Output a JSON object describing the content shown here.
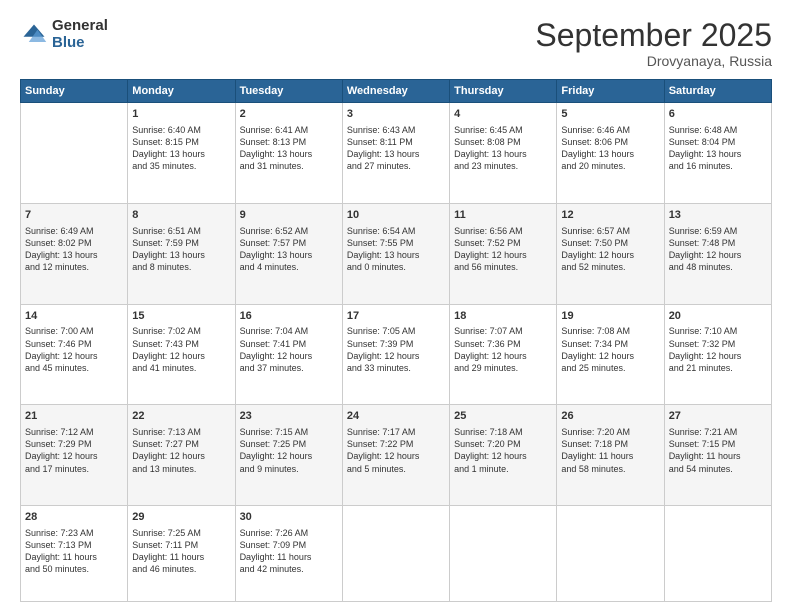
{
  "logo": {
    "general": "General",
    "blue": "Blue"
  },
  "header": {
    "month": "September 2025",
    "location": "Drovyanaya, Russia"
  },
  "weekdays": [
    "Sunday",
    "Monday",
    "Tuesday",
    "Wednesday",
    "Thursday",
    "Friday",
    "Saturday"
  ],
  "weeks": [
    [
      {
        "day": "",
        "content": ""
      },
      {
        "day": "1",
        "content": "Sunrise: 6:40 AM\nSunset: 8:15 PM\nDaylight: 13 hours\nand 35 minutes."
      },
      {
        "day": "2",
        "content": "Sunrise: 6:41 AM\nSunset: 8:13 PM\nDaylight: 13 hours\nand 31 minutes."
      },
      {
        "day": "3",
        "content": "Sunrise: 6:43 AM\nSunset: 8:11 PM\nDaylight: 13 hours\nand 27 minutes."
      },
      {
        "day": "4",
        "content": "Sunrise: 6:45 AM\nSunset: 8:08 PM\nDaylight: 13 hours\nand 23 minutes."
      },
      {
        "day": "5",
        "content": "Sunrise: 6:46 AM\nSunset: 8:06 PM\nDaylight: 13 hours\nand 20 minutes."
      },
      {
        "day": "6",
        "content": "Sunrise: 6:48 AM\nSunset: 8:04 PM\nDaylight: 13 hours\nand 16 minutes."
      }
    ],
    [
      {
        "day": "7",
        "content": "Sunrise: 6:49 AM\nSunset: 8:02 PM\nDaylight: 13 hours\nand 12 minutes."
      },
      {
        "day": "8",
        "content": "Sunrise: 6:51 AM\nSunset: 7:59 PM\nDaylight: 13 hours\nand 8 minutes."
      },
      {
        "day": "9",
        "content": "Sunrise: 6:52 AM\nSunset: 7:57 PM\nDaylight: 13 hours\nand 4 minutes."
      },
      {
        "day": "10",
        "content": "Sunrise: 6:54 AM\nSunset: 7:55 PM\nDaylight: 13 hours\nand 0 minutes."
      },
      {
        "day": "11",
        "content": "Sunrise: 6:56 AM\nSunset: 7:52 PM\nDaylight: 12 hours\nand 56 minutes."
      },
      {
        "day": "12",
        "content": "Sunrise: 6:57 AM\nSunset: 7:50 PM\nDaylight: 12 hours\nand 52 minutes."
      },
      {
        "day": "13",
        "content": "Sunrise: 6:59 AM\nSunset: 7:48 PM\nDaylight: 12 hours\nand 48 minutes."
      }
    ],
    [
      {
        "day": "14",
        "content": "Sunrise: 7:00 AM\nSunset: 7:46 PM\nDaylight: 12 hours\nand 45 minutes."
      },
      {
        "day": "15",
        "content": "Sunrise: 7:02 AM\nSunset: 7:43 PM\nDaylight: 12 hours\nand 41 minutes."
      },
      {
        "day": "16",
        "content": "Sunrise: 7:04 AM\nSunset: 7:41 PM\nDaylight: 12 hours\nand 37 minutes."
      },
      {
        "day": "17",
        "content": "Sunrise: 7:05 AM\nSunset: 7:39 PM\nDaylight: 12 hours\nand 33 minutes."
      },
      {
        "day": "18",
        "content": "Sunrise: 7:07 AM\nSunset: 7:36 PM\nDaylight: 12 hours\nand 29 minutes."
      },
      {
        "day": "19",
        "content": "Sunrise: 7:08 AM\nSunset: 7:34 PM\nDaylight: 12 hours\nand 25 minutes."
      },
      {
        "day": "20",
        "content": "Sunrise: 7:10 AM\nSunset: 7:32 PM\nDaylight: 12 hours\nand 21 minutes."
      }
    ],
    [
      {
        "day": "21",
        "content": "Sunrise: 7:12 AM\nSunset: 7:29 PM\nDaylight: 12 hours\nand 17 minutes."
      },
      {
        "day": "22",
        "content": "Sunrise: 7:13 AM\nSunset: 7:27 PM\nDaylight: 12 hours\nand 13 minutes."
      },
      {
        "day": "23",
        "content": "Sunrise: 7:15 AM\nSunset: 7:25 PM\nDaylight: 12 hours\nand 9 minutes."
      },
      {
        "day": "24",
        "content": "Sunrise: 7:17 AM\nSunset: 7:22 PM\nDaylight: 12 hours\nand 5 minutes."
      },
      {
        "day": "25",
        "content": "Sunrise: 7:18 AM\nSunset: 7:20 PM\nDaylight: 12 hours\nand 1 minute."
      },
      {
        "day": "26",
        "content": "Sunrise: 7:20 AM\nSunset: 7:18 PM\nDaylight: 11 hours\nand 58 minutes."
      },
      {
        "day": "27",
        "content": "Sunrise: 7:21 AM\nSunset: 7:15 PM\nDaylight: 11 hours\nand 54 minutes."
      }
    ],
    [
      {
        "day": "28",
        "content": "Sunrise: 7:23 AM\nSunset: 7:13 PM\nDaylight: 11 hours\nand 50 minutes."
      },
      {
        "day": "29",
        "content": "Sunrise: 7:25 AM\nSunset: 7:11 PM\nDaylight: 11 hours\nand 46 minutes."
      },
      {
        "day": "30",
        "content": "Sunrise: 7:26 AM\nSunset: 7:09 PM\nDaylight: 11 hours\nand 42 minutes."
      },
      {
        "day": "",
        "content": ""
      },
      {
        "day": "",
        "content": ""
      },
      {
        "day": "",
        "content": ""
      },
      {
        "day": "",
        "content": ""
      }
    ]
  ]
}
